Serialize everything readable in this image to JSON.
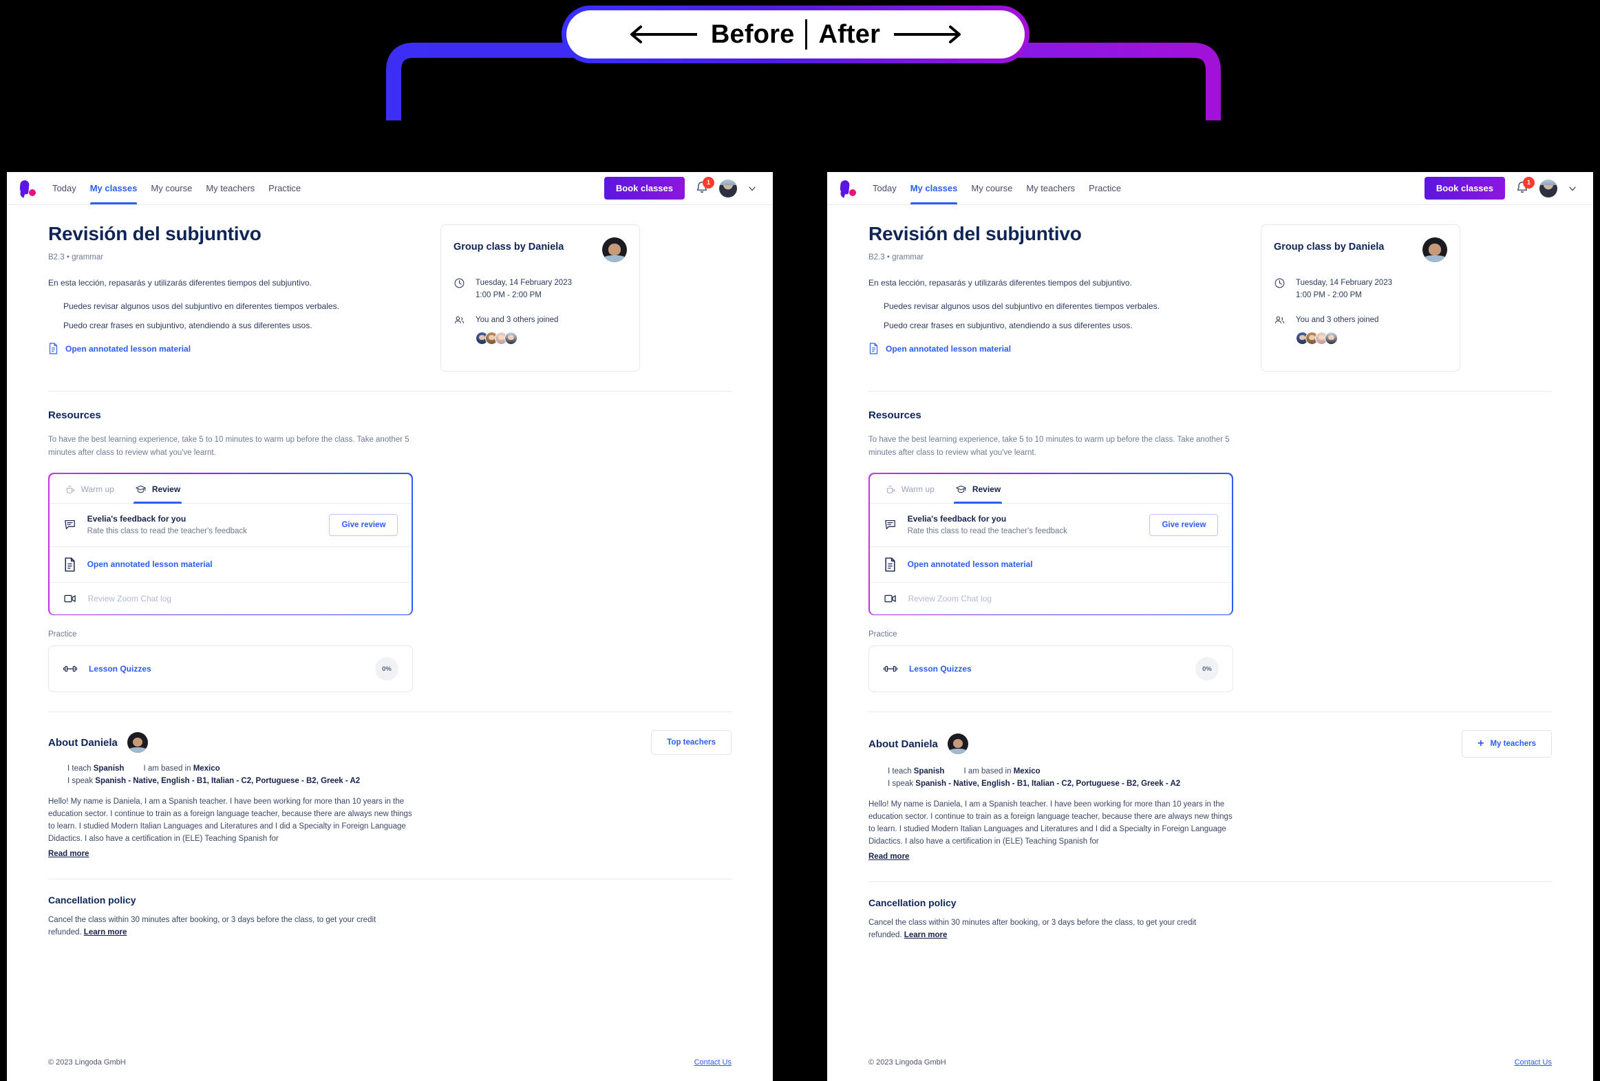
{
  "banner": {
    "before_label": "Before",
    "after_label": "After",
    "left_arrow_icon": "long-arrow-left-icon",
    "right_arrow_icon": "long-arrow-right-icon",
    "accent_start": "#3730ff",
    "accent_end": "#a211d8"
  },
  "header": {
    "logo_name": "lingoda-logo",
    "nav": [
      {
        "label": "Today",
        "active": false
      },
      {
        "label": "My classes",
        "active": true
      },
      {
        "label": "My course",
        "active": false
      },
      {
        "label": "My teachers",
        "active": false
      },
      {
        "label": "Practice",
        "active": false
      }
    ],
    "book_classes_label": "Book classes",
    "notification_count": "1",
    "bell_icon": "bell-icon",
    "avatar_icon": "user-avatar",
    "chevron_icon": "chevron-down-icon",
    "accent_color": "#2b5cf6",
    "brand_gradient_start": "#5b17e0",
    "brand_gradient_end": "#8d16e0"
  },
  "lesson": {
    "title": "Revisión del subjuntivo",
    "subtitle": "B2.3 • grammar",
    "intro": "En esta lección, repasarás y utilizarás diferentes tiempos del subjuntivo.",
    "objectives": [
      "Puedes revisar algunos usos del subjuntivo en diferentes tiempos verbales.",
      "Puedo crear frases en subjuntivo, atendiendo a sus diferentes usos."
    ],
    "material_link": "Open annotated lesson material",
    "material_icon": "document-icon"
  },
  "group_class": {
    "title": "Group class by Daniela",
    "teacher_avatar": "teacher-avatar",
    "clock_icon": "clock-icon",
    "date": "Tuesday, 14 February 2023",
    "time": "1:00 PM - 2:00 PM",
    "people_icon": "people-icon",
    "joined_text": "You and 3 others joined",
    "participants": [
      "participant-1",
      "participant-2",
      "participant-3",
      "participant-4"
    ]
  },
  "resources": {
    "heading": "Resources",
    "description": "To have the best learning experience, take 5 to 10 minutes to warm up before the class. Take another 5 minutes after class to review what you've learnt.",
    "tabs": [
      {
        "label": "Warm up",
        "icon": "hot-drink-icon",
        "active": false
      },
      {
        "label": "Review",
        "icon": "graduation-cap-icon",
        "active": true
      }
    ],
    "rows": [
      {
        "icon": "chat-bubble-icon",
        "title": "Evelia's feedback for you",
        "subtitle": "Rate this class to read the teacher's feedback",
        "button": "Give review"
      },
      {
        "icon": "document-icon",
        "link": "Open annotated lesson material"
      },
      {
        "icon": "video-icon",
        "disabled_text": "Review Zoom Chat log"
      }
    ]
  },
  "practice": {
    "label": "Practice",
    "icon": "dumbbell-icon",
    "link": "Lesson Quizzes",
    "progress": "0%"
  },
  "about": {
    "title": "About Daniela",
    "avatar": "teacher-avatar",
    "button_before": "Top teachers",
    "button_after": "My teachers",
    "button_after_icon": "plus-icon",
    "teach_prefix": "I teach ",
    "teach_value": "Spanish",
    "based_prefix": "I am based in ",
    "based_value": "Mexico",
    "speak_prefix": "I speak ",
    "speak_value": "Spanish - Native, English - B1, Italian - C2, Portuguese - B2, Greek - A2",
    "bio": "Hello! My name is Daniela, I am a Spanish teacher. I have been working for more than 10 years in the education sector. I continue to train as a foreign language teacher, because there are always new things to learn. I studied Modern Italian Languages and Literatures and I did a Specialty in Foreign Language Didactics. I also have a certification in (ELE) Teaching Spanish for",
    "read_more": "Read more"
  },
  "cancellation": {
    "heading": "Cancellation policy",
    "text": "Cancel the class within 30 minutes after booking, or 3 days before the class, to get your credit refunded. ",
    "learn_more": "Learn more"
  },
  "footer": {
    "copyright": "© 2023 Lingoda GmbH",
    "contact": "Contact Us"
  }
}
